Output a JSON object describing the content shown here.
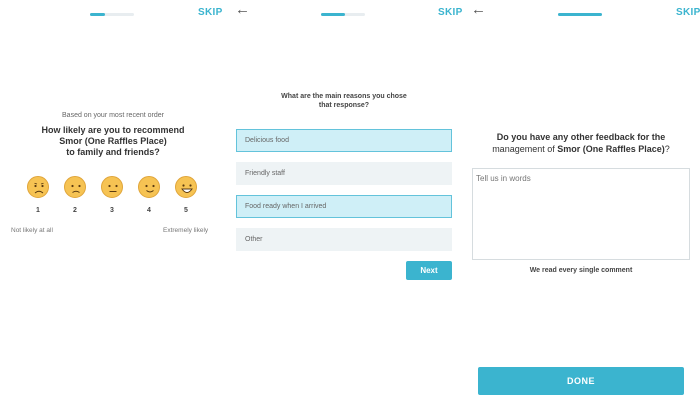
{
  "colors": {
    "accent": "#3bb4cf",
    "selected_bg": "#cfeff7",
    "option_bg": "#eef3f5",
    "face": "#f6c353"
  },
  "screen1": {
    "skip": "SKIP",
    "progress_fraction": 0.33,
    "context": "Based on your most recent order",
    "question_line1": "How likely are you to recommend",
    "question_line2": "Smor (One Raffles Place)",
    "question_line3": "to family and friends?",
    "ratings": [
      {
        "value": "1",
        "icon": "very-sad-face-icon"
      },
      {
        "value": "2",
        "icon": "sad-face-icon"
      },
      {
        "value": "3",
        "icon": "neutral-face-icon"
      },
      {
        "value": "4",
        "icon": "happy-face-icon"
      },
      {
        "value": "5",
        "icon": "very-happy-face-icon"
      }
    ],
    "low_label": "Not likely at all",
    "high_label": "Extremely likely"
  },
  "screen2": {
    "back_icon": "arrow-left-icon",
    "skip": "SKIP",
    "progress_fraction": 0.55,
    "question_line1": "What are the main reasons you chose",
    "question_line2": "that response?",
    "options": [
      {
        "label": "Delicious food",
        "selected": true
      },
      {
        "label": "Friendly staff",
        "selected": false
      },
      {
        "label": "Food ready when I arrived",
        "selected": true
      },
      {
        "label": "Other",
        "selected": false
      }
    ],
    "next": "Next"
  },
  "screen3": {
    "back_icon": "arrow-left-icon",
    "skip": "SKIP",
    "progress_fraction": 1.0,
    "question_line1": "Do you have any other feedback for the",
    "question_line2_prefix": "management of ",
    "question_line2_bold": "Smor (One Raffles Place)",
    "question_line2_suffix": "?",
    "textarea_placeholder": "Tell us in words",
    "note": "We read every single comment",
    "done": "DONE"
  }
}
